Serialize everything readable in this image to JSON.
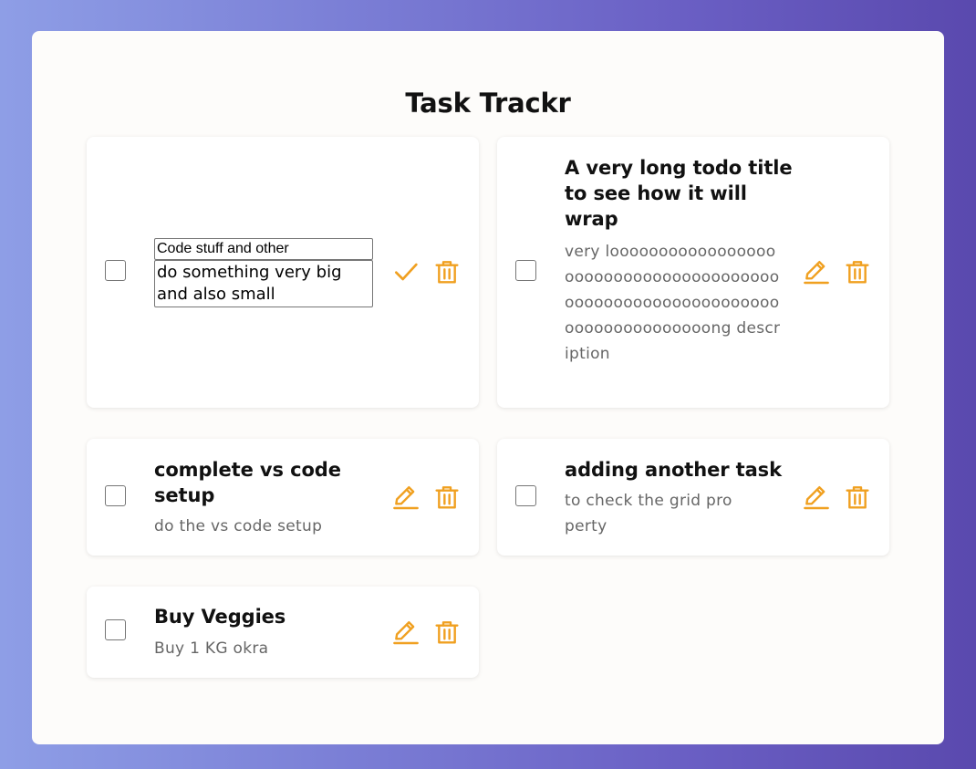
{
  "app": {
    "title": "Task Trackr"
  },
  "colors": {
    "accent": "#f0a020",
    "panel": "#fdfcfa"
  },
  "tasks": [
    {
      "editing": true,
      "checked": false,
      "title_value": "Code stuff and other",
      "description_value": "do something very big and also small",
      "icons": [
        "checkmark-icon",
        "trash-icon"
      ]
    },
    {
      "checked": false,
      "title": "A very long todo title to see how it will wrap",
      "description": "very loooooooooooooooooooooooooooooooooooooooooooooooooooooooooooooooooooooooooooong description",
      "icons": [
        "pencil-icon",
        "trash-icon"
      ]
    },
    {
      "checked": false,
      "title": "complete vs code setup",
      "description": "do the vs code setup",
      "icons": [
        "pencil-icon",
        "trash-icon"
      ]
    },
    {
      "checked": false,
      "title": "adding another task",
      "description": "to check the grid property",
      "icons": [
        "pencil-icon",
        "trash-icon"
      ]
    },
    {
      "checked": false,
      "title": "Buy Veggies",
      "description": "Buy 1 KG okra",
      "icons": [
        "pencil-icon",
        "trash-icon"
      ]
    }
  ]
}
